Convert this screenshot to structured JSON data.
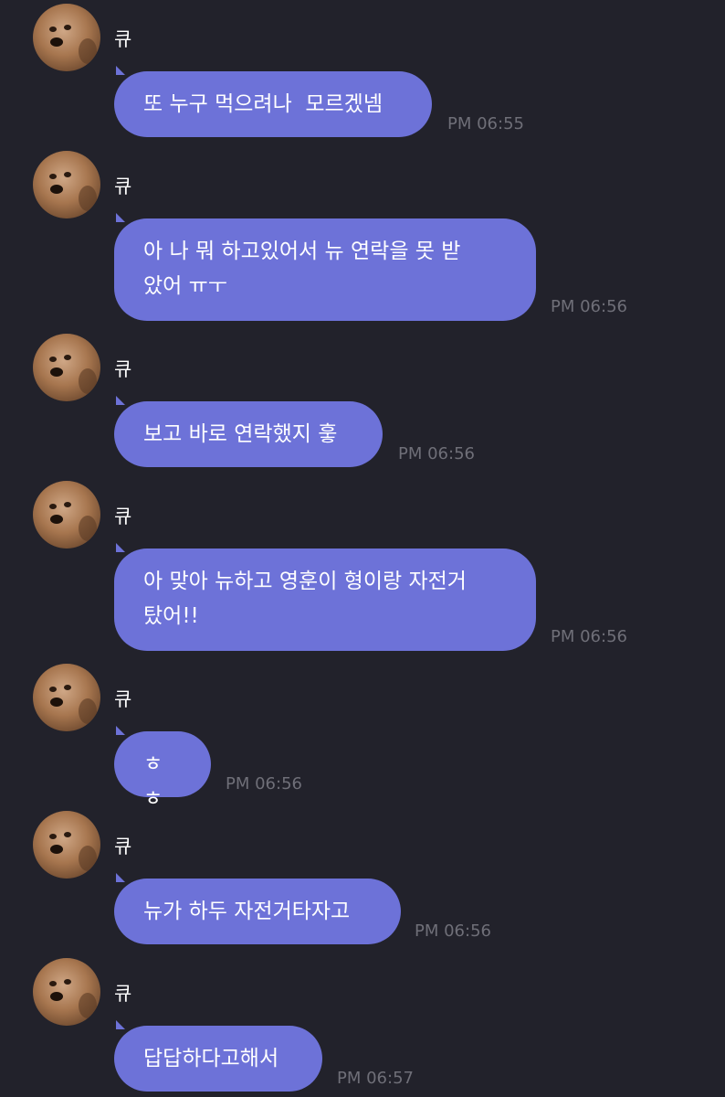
{
  "messages": [
    {
      "sender": "큐",
      "text": "또 누구 먹으려나  모르겠넴",
      "time": "PM 06:55"
    },
    {
      "sender": "큐",
      "text": "아 나 뭐 하고있어서 뉴 연락을 못 받\n았어 ㅠㅜ",
      "time": "PM 06:56"
    },
    {
      "sender": "큐",
      "text": "보고 바로 연락했지 훟",
      "time": "PM 06:56"
    },
    {
      "sender": "큐",
      "text": "아 맞아 뉴하고 영훈이 형이랑 자전거\n탔어!!",
      "time": "PM 06:56"
    },
    {
      "sender": "큐",
      "text": "ㅎㅎ",
      "time": "PM 06:56"
    },
    {
      "sender": "큐",
      "text": "뉴가 하두 자전거타자고",
      "time": "PM 06:56"
    },
    {
      "sender": "큐",
      "text": "답답하다고해서",
      "time": "PM 06:57"
    }
  ],
  "avatar_icon": "dog-photo-avatar",
  "colors": {
    "background": "#22222b",
    "bubble": "#6d72d8",
    "time": "#6f6f78",
    "text": "#ffffff"
  }
}
